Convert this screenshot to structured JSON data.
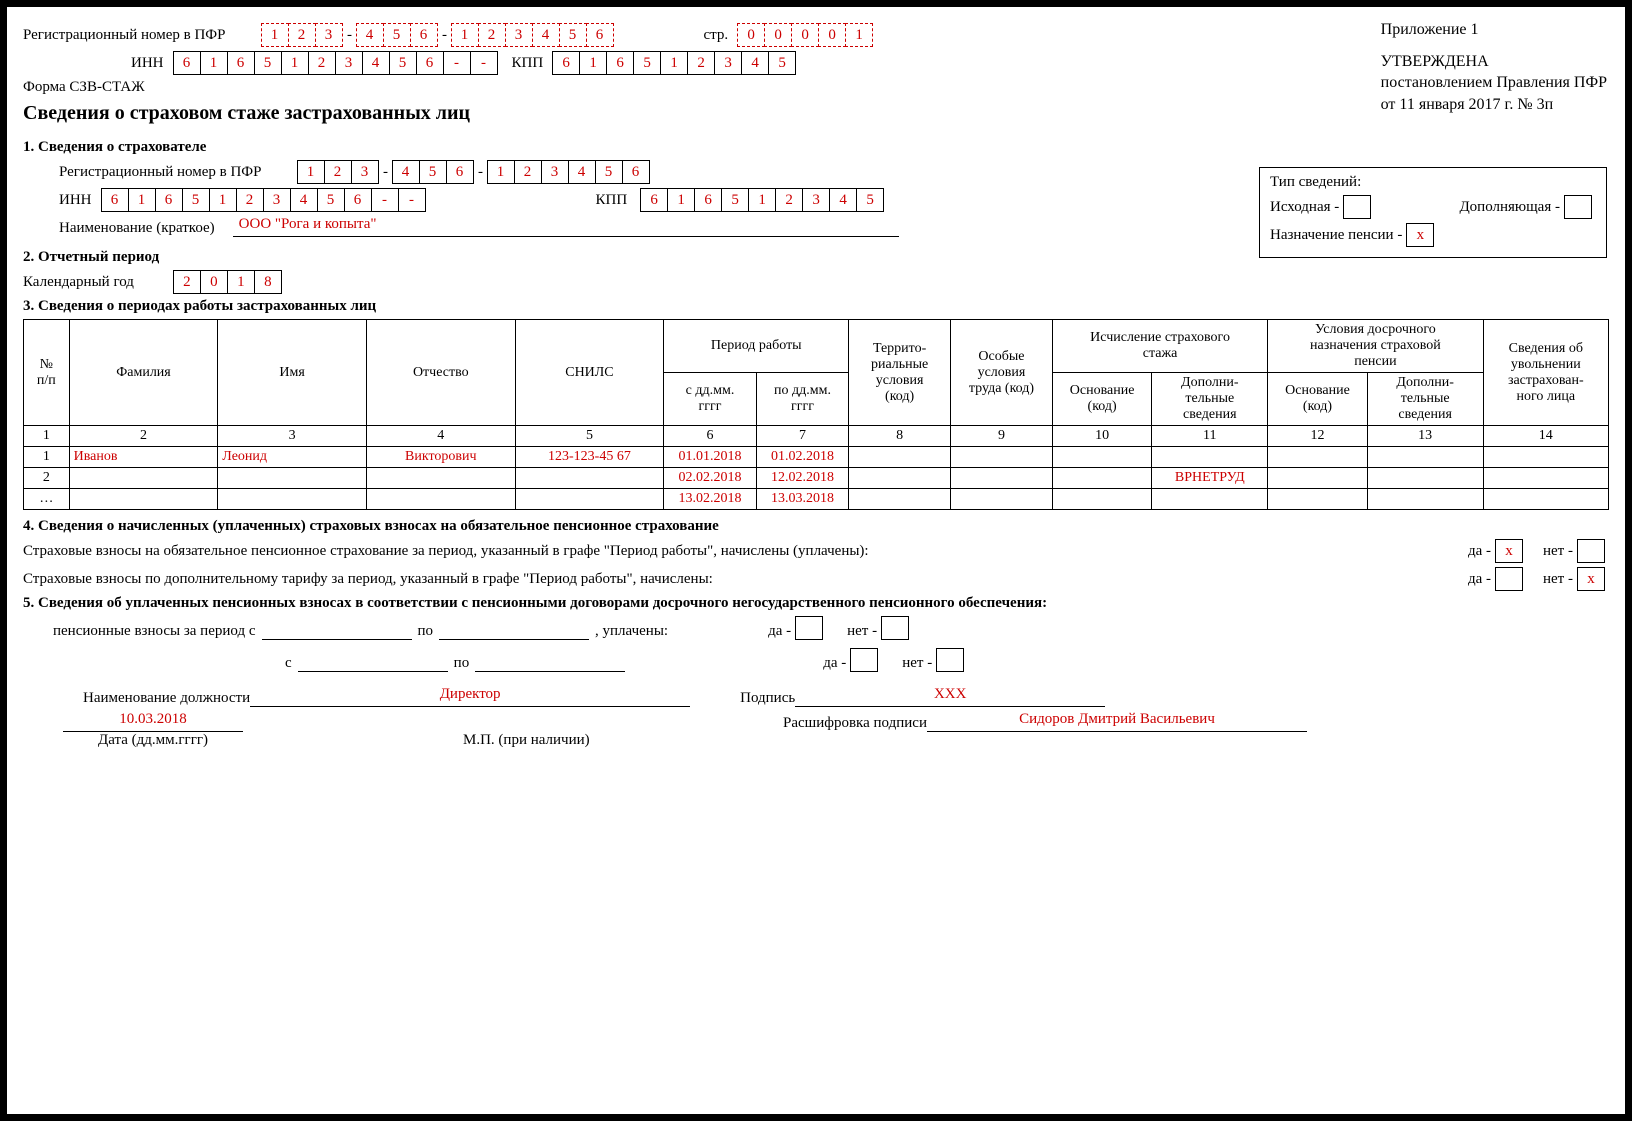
{
  "header": {
    "reg_label": "Регистрационный номер в ПФР",
    "reg_top": [
      "1",
      "2",
      "3",
      "4",
      "5",
      "6",
      "1",
      "2",
      "3",
      "4",
      "5",
      "6"
    ],
    "page_label": "стр.",
    "page_digits": [
      "0",
      "0",
      "0",
      "0",
      "1"
    ],
    "inn_label": "ИНН",
    "inn": [
      "6",
      "1",
      "6",
      "5",
      "1",
      "2",
      "3",
      "4",
      "5",
      "6",
      "-",
      "-"
    ],
    "kpp_label": "КПП",
    "kpp": [
      "6",
      "1",
      "6",
      "5",
      "1",
      "2",
      "3",
      "4",
      "5"
    ],
    "form": "Форма СЗВ-СТАЖ",
    "title": "Сведения о страховом стаже застрахованных лиц"
  },
  "approval": {
    "app": "Приложение 1",
    "line1": "УТВЕРЖДЕНА",
    "line2": "постановлением Правления ПФР",
    "line3": "от 11 января 2017 г. № 3п"
  },
  "s1": {
    "h": "1. Сведения о страхователе",
    "reg_label": "Регистрационный номер в ПФР",
    "reg": [
      "1",
      "2",
      "3",
      "4",
      "5",
      "6",
      "1",
      "2",
      "3",
      "4",
      "5",
      "6"
    ],
    "inn_label": "ИНН",
    "inn": [
      "6",
      "1",
      "6",
      "5",
      "1",
      "2",
      "3",
      "4",
      "5",
      "6",
      "-",
      "-"
    ],
    "kpp_label": "КПП",
    "kpp": [
      "6",
      "1",
      "6",
      "5",
      "1",
      "2",
      "3",
      "4",
      "5"
    ],
    "name_label": "Наименование (краткое)",
    "name_value": "ООО \"Рога и копыта\""
  },
  "type_box": {
    "h": "Тип сведений:",
    "l1": "Исходная -",
    "l2": "Дополняющая -",
    "l3": "Назначение пенсии -",
    "v3": "x"
  },
  "s2": {
    "h": "2. Отчетный период",
    "label": "Календарный год",
    "year": [
      "2",
      "0",
      "1",
      "8"
    ]
  },
  "s3": {
    "h": "3. Сведения о периодах работы застрахованных лиц",
    "cols": [
      "№\nп/п",
      "Фамилия",
      "Имя",
      "Отчество",
      "СНИЛС",
      "Период работы",
      "",
      "Террито-\nриальные\nусловия\n(код)",
      "Особые\nусловия\nтруда (код)",
      "Исчисление страхового\nстажа",
      "",
      "Условия досрочного\nназначения страховой\nпенсии",
      "",
      "Сведения об\nувольнении\nзастрахован-\nного лица"
    ],
    "sub": [
      "с дд.мм.\nгггг",
      "по дд.мм.\nгггг",
      "Основание\n(код)",
      "Дополни-\nтельные\nсведения",
      "Основание\n(код)",
      "Дополни-\nтельные\nсведения"
    ],
    "nums": [
      "1",
      "2",
      "3",
      "4",
      "5",
      "6",
      "7",
      "8",
      "9",
      "10",
      "11",
      "12",
      "13",
      "14"
    ],
    "rows": [
      {
        "n": "1",
        "ln": "Иванов",
        "fn": "Леонид",
        "pn": "Викторович",
        "snils": "123-123-45 67",
        "from": "01.01.2018",
        "to": "01.02.2018",
        "c11": ""
      },
      {
        "n": "2",
        "ln": "",
        "fn": "",
        "pn": "",
        "snils": "",
        "from": "02.02.2018",
        "to": "12.02.2018",
        "c11": "ВРНЕТРУД"
      },
      {
        "n": "…",
        "ln": "",
        "fn": "",
        "pn": "",
        "snils": "",
        "from": "13.02.2018",
        "to": "13.03.2018",
        "c11": ""
      }
    ]
  },
  "s4": {
    "h": "4. Сведения о начисленных (уплаченных) страховых взносах на обязательное пенсионное страхование",
    "l1": "Страховые взносы на обязательное пенсионное страхование за период, указанный в графе \"Период работы\", начислены (уплачены):",
    "l2": "Страховые взносы по дополнительному тарифу за период, указанный в графе \"Период работы\", начислены:",
    "yes": "да -",
    "no": "нет -",
    "v1_yes": "x",
    "v1_no": "",
    "v2_yes": "",
    "v2_no": "x"
  },
  "s5": {
    "h": "5. Сведения об уплаченных пенсионных взносах в соответствии с пенсионными договорами досрочного негосударственного пенсионного обеспечения:",
    "l1a": "пенсионные взносы за период с",
    "l1b": "по",
    "l1c": ", уплачены:",
    "l2a": "с",
    "l2b": "по",
    "yes": "да -",
    "no": "нет -"
  },
  "sign": {
    "pos_label": "Наименование должности",
    "pos": "Директор",
    "sig_label": "Подпись",
    "sig": "XXX",
    "date": "10.03.2018",
    "date_label": "Дата (дд.мм.гггг)",
    "name_label": "Расшифровка подписи",
    "name": "Сидоров Дмитрий Васильевич",
    "mp": "М.П. (при наличии)"
  }
}
